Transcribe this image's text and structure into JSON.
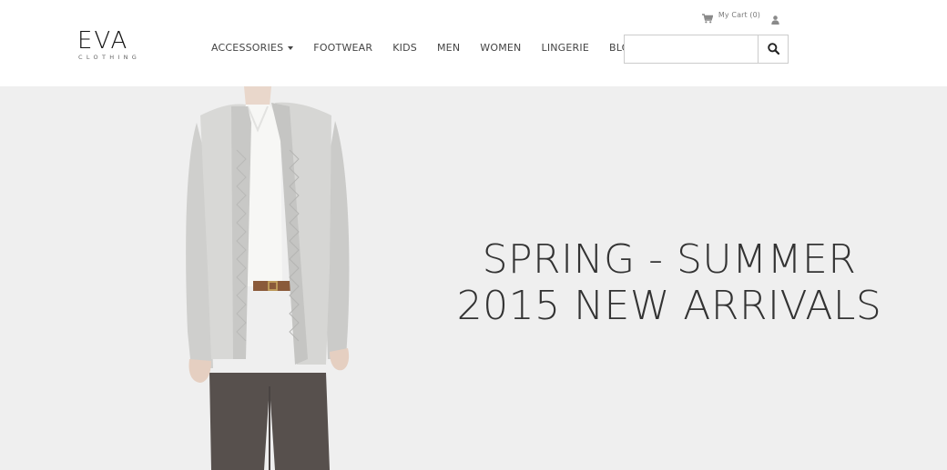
{
  "header": {
    "logo": {
      "main": "EVA",
      "sub": "CLOTHING"
    },
    "cart_label": "My Cart (0)",
    "icons": {
      "cart": "shopping-cart-icon",
      "user": "user-icon",
      "search": "search-icon"
    },
    "nav": [
      {
        "label": "ACCESSORIES",
        "has_dropdown": true
      },
      {
        "label": "FOOTWEAR"
      },
      {
        "label": "KIDS"
      },
      {
        "label": "MEN"
      },
      {
        "label": "WOMEN"
      },
      {
        "label": "LINGERIE"
      },
      {
        "label": "BLOG"
      }
    ],
    "search": {
      "value": "",
      "placeholder": ""
    }
  },
  "hero": {
    "headline_line1": "SPRING - SUMMER",
    "headline_line2": "2015 NEW ARRIVALS",
    "background_color": "#efefef"
  }
}
